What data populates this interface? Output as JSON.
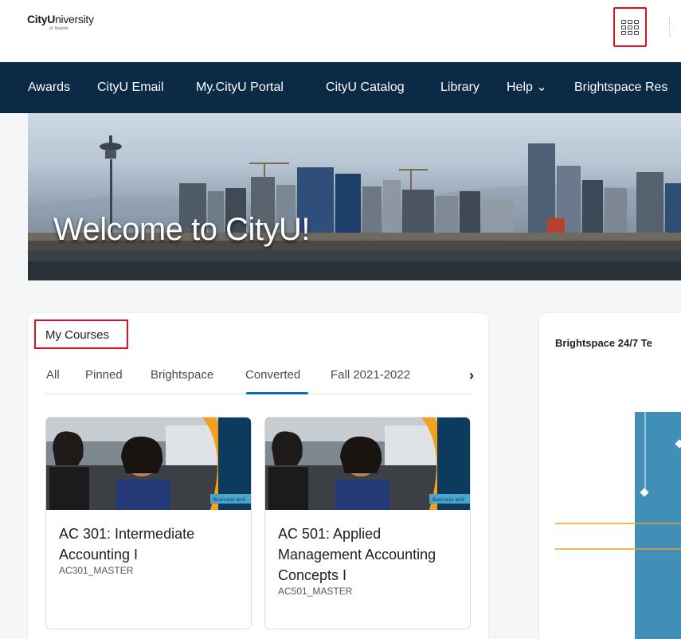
{
  "logo": {
    "main_bold": "CityU",
    "main_rest": "niversity",
    "sub": "of Seattle"
  },
  "nav": {
    "items": [
      {
        "label": "Awards"
      },
      {
        "label": "CityU Email"
      },
      {
        "label": "My.CityU Portal"
      },
      {
        "label": "CityU Catalog"
      },
      {
        "label": "Library"
      },
      {
        "label": "Help ⌄"
      },
      {
        "label": "Brightspace Res"
      }
    ]
  },
  "banner": {
    "title": "Welcome to CityU!"
  },
  "my_courses": {
    "heading": "My Courses",
    "tabs": [
      {
        "label": "All"
      },
      {
        "label": "Pinned"
      },
      {
        "label": "Brightspace"
      },
      {
        "label": "Converted"
      },
      {
        "label": "Fall 2021-2022"
      }
    ],
    "active_tab": "Converted",
    "next_icon": "chevron-right-icon",
    "next_glyph": "›",
    "courses": [
      {
        "title": "AC 301: Intermediate Accounting I",
        "code": "AC301_MASTER",
        "image_badge": "Business and"
      },
      {
        "title": "AC 501: Applied Management Accounting Concepts I",
        "code": "AC501_MASTER",
        "image_badge": "Business and"
      }
    ]
  },
  "right_widget": {
    "heading": "Brightspace 24/7 Te"
  },
  "icons": {
    "app_launcher": "waffle-grid-icon"
  },
  "colors": {
    "navbar": "#0b2a45",
    "highlight": "#e0101d",
    "active_tab": "#006fbf",
    "accent_orange": "#f2a01e",
    "panel_teal": "#3f8fb9"
  }
}
